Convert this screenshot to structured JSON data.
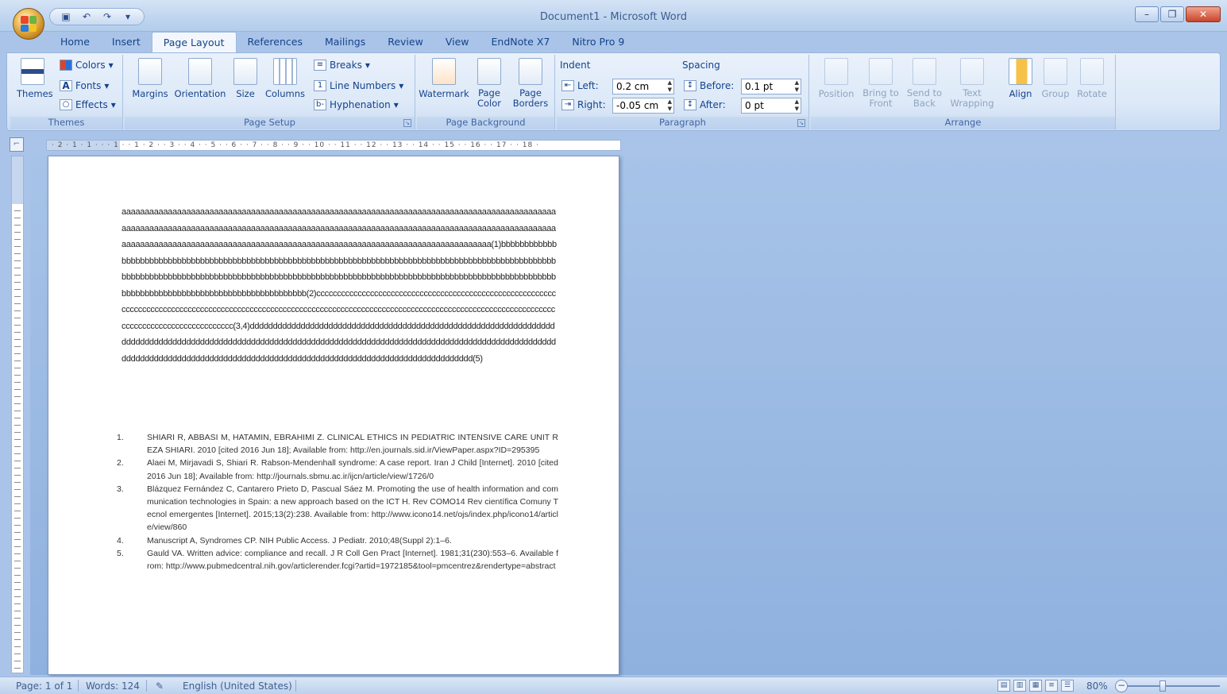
{
  "window": {
    "title": "Document1 - Microsoft Word"
  },
  "qat": {
    "save_icon": "save-icon",
    "undo_icon": "undo-icon",
    "redo_icon": "redo-icon"
  },
  "tabs": [
    "Home",
    "Insert",
    "Page Layout",
    "References",
    "Mailings",
    "Review",
    "View",
    "EndNote X7",
    "Nitro Pro 9"
  ],
  "ribbon": {
    "themes": {
      "label": "Themes",
      "themes_btn": "Themes",
      "colors": "Colors",
      "fonts": "Fonts",
      "effects": "Effects"
    },
    "page_setup": {
      "label": "Page Setup",
      "margins": "Margins",
      "orientation": "Orientation",
      "size": "Size",
      "columns": "Columns",
      "breaks": "Breaks",
      "line_numbers": "Line Numbers",
      "hyphenation": "Hyphenation"
    },
    "page_background": {
      "label": "Page Background",
      "watermark": "Watermark",
      "page_color": "Page Color",
      "page_borders": "Page Borders"
    },
    "paragraph": {
      "label": "Paragraph",
      "indent": "Indent",
      "left_label": "Left:",
      "left_value": "0.2 cm",
      "right_label": "Right:",
      "right_value": "-0.05 cm",
      "spacing": "Spacing",
      "before_label": "Before:",
      "before_value": "0.1 pt",
      "after_label": "After:",
      "after_value": "0 pt"
    },
    "arrange": {
      "label": "Arrange",
      "position": "Position",
      "bring_to_front": "Bring to Front",
      "send_to_back": "Send to Back",
      "text_wrapping": "Text Wrapping",
      "align": "Align",
      "group": "Group",
      "rotate": "Rotate"
    }
  },
  "ruler": {
    "ticks": "· 2 · 1 · 1 · · · 1 · · 1 · 2 · · 3 · · 4 · · 5 · · 6 · · 7 · · 8 · · 9 · · 10 · · 11 · · 12 · · 13 · · 14 · · 15 · · 16 · · 17 · · 18 ·"
  },
  "document": {
    "body": "aaaaaaaaaaaaaaaaaaaaaaaaaaaaaaaaaaaaaaaaaaaaaaaaaaaaaaaaaaaaaaaaaaaaaaaaaaaaaaaaaaaaaaaaaaaaaaaaaaaaaaaaaaaaaaaaaaaaaaaaaaaaaaaaaaaaaaaaaaaaaaaaaaaaaaaaaaaaaaaaaaaaaaaaaaaaaaaaaaaaaaaaaaaaaaaaaaaaaaaaaaaaaaaaaaaaaaaaaaaaaaaaaaaaaaaaaaaaaaaaaaaaaaaaaaaaaaaaaaaaaaaaaaaa(1)bbbbbbbbbbbbbbbbbbbbbbbbbbbbbbbbbbbbbbbbbbbbbbbbbbbbbbbbbbbbbbbbbbbbbbbbbbbbbbbbbbbbbbbbbbbbbbbbbbbbbbbbbbbbbbbbbbbbbbbbbbbbbbbbbbbbbbbbbbbbbbbbbbbbbbbbbbbbbbbbbbbbbbbbbbbbbbbbbbbbbbbbbbbbbbbbbbbbbbbbbbbbbbbbbbbbbbbbbbbbbbbbbbbbbbbbbbbbbbbb(2)cccccccccccccccccccccccccccccccccccccccccccccccccccccccccccccccccccccccccccccccccccccccccccccccccccccccccccccccccccccccccccccccccccccccccccccccccccccccccccccccccccccccccccccccccccccccccccccc(3,4)dddddddddddddddddddddddddddddddddddddddddddddddddddddddddddddddddddddddddddddddddddddddddddddddddddddddddddddddddddddddddddddddddddddddddddddddddddddddddddddddddddddddddddddddddddddddddddddddddddddddddddddddddddddddddddddddddddddddddddd(5)",
    "references": [
      {
        "num": "1.",
        "text": "SHIARI R, ABBASI M, HATAMIN, EBRAHIMI Z. CLINICAL ETHICS IN PEDIATRIC INTENSIVE CARE UNIT REZA SHIARI. 2010 [cited 2016 Jun 18]; Available from: http://en.journals.sid.ir/ViewPaper.aspx?ID=295395"
      },
      {
        "num": "2.",
        "text": "Alaei M, Mirjavadi S, Shiari R. Rabson-Mendenhall syndrome: A case report. Iran J Child [Internet]. 2010 [cited 2016 Jun 18]; Available from: http://journals.sbmu.ac.ir/ijcn/article/view/1726/0"
      },
      {
        "num": "3.",
        "text": "Blázquez Fernández C, Cantarero Prieto D, Pascual Sáez M. Promoting the use of health information and communication technologies in Spain: a new approach based on the ICT H. Rev COMO14 Rev científica Comuny Tecnol emergentes [Internet]. 2015;13(2):238. Available from: http://www.icono14.net/ojs/index.php/icono14/article/view/860"
      },
      {
        "num": "4.",
        "text": "Manuscript A, Syndromes CP. NIH Public Access. J Pediatr. 2010;48(Suppl 2):1–6."
      },
      {
        "num": "5.",
        "text": "Gauld VA. Written advice: compliance and recall. J R Coll Gen Pract [Internet]. 1981;31(230):553–6. Available from: http://www.pubmedcentral.nih.gov/articlerender.fcgi?artid=1972185&tool=pmcentrez&rendertype=abstract"
      }
    ]
  },
  "status": {
    "page": "Page: 1 of 1",
    "words": "Words: 124",
    "language": "English (United States)",
    "zoom": "80%"
  }
}
